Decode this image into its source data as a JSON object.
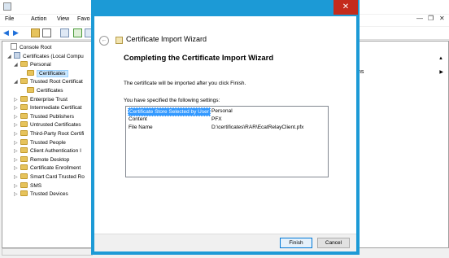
{
  "mmc": {
    "menu": [
      "File",
      "Action",
      "View",
      "Favo"
    ],
    "tree": [
      {
        "label": "Console Root",
        "level": 0,
        "kind": "root",
        "exp": ""
      },
      {
        "label": "Certificates (Local Compu",
        "level": 1,
        "kind": "cert",
        "exp": "◢"
      },
      {
        "label": "Personal",
        "level": 2,
        "kind": "fold",
        "exp": "◢"
      },
      {
        "label": "Certificates",
        "level": 3,
        "kind": "fold",
        "exp": "",
        "selected": true
      },
      {
        "label": "Trusted Root Certificat",
        "level": 2,
        "kind": "fold",
        "exp": "◢"
      },
      {
        "label": "Certificates",
        "level": 3,
        "kind": "fold",
        "exp": ""
      },
      {
        "label": "Enterprise Trust",
        "level": 2,
        "kind": "fold",
        "exp": "▷"
      },
      {
        "label": "Intermediate Certificat",
        "level": 2,
        "kind": "fold",
        "exp": "▷"
      },
      {
        "label": "Trusted Publishers",
        "level": 2,
        "kind": "fold",
        "exp": "▷"
      },
      {
        "label": "Untrusted Certificates",
        "level": 2,
        "kind": "fold",
        "exp": "▷"
      },
      {
        "label": "Third-Party Root Certifi",
        "level": 2,
        "kind": "fold",
        "exp": "▷"
      },
      {
        "label": "Trusted People",
        "level": 2,
        "kind": "fold",
        "exp": "▷"
      },
      {
        "label": "Client Authentication I",
        "level": 2,
        "kind": "fold",
        "exp": "▷"
      },
      {
        "label": "Remote Desktop",
        "level": 2,
        "kind": "fold",
        "exp": "▷"
      },
      {
        "label": "Certificate Enrollment",
        "level": 2,
        "kind": "fold",
        "exp": "▷"
      },
      {
        "label": "Smart Card Trusted Ro",
        "level": 2,
        "kind": "fold",
        "exp": "▷"
      },
      {
        "label": "SMS",
        "level": 2,
        "kind": "fold",
        "exp": "▷"
      },
      {
        "label": "Trusted Devices",
        "level": 2,
        "kind": "fold",
        "exp": "▷"
      }
    ],
    "right_pane": {
      "item": "ns"
    },
    "controls": {
      "minimize": "—",
      "restore": "❐",
      "close": "✕"
    }
  },
  "dialog": {
    "title": "Certificate Import Wizard",
    "heading": "Completing the Certificate Import Wizard",
    "description": "The certificate will be imported after you click Finish.",
    "settings_label": "You have specified the following settings:",
    "settings": [
      {
        "key": "Certificate Store Selected by User",
        "value": "Personal",
        "selected": true
      },
      {
        "key": "Content",
        "value": "PFX"
      },
      {
        "key": "File Name",
        "value": "D:\\certificates\\RAR\\EcatRelayClient.pfx"
      }
    ],
    "finish_label": "Finish",
    "cancel_label": "Cancel",
    "close_glyph": "✕",
    "back_glyph": "←"
  }
}
